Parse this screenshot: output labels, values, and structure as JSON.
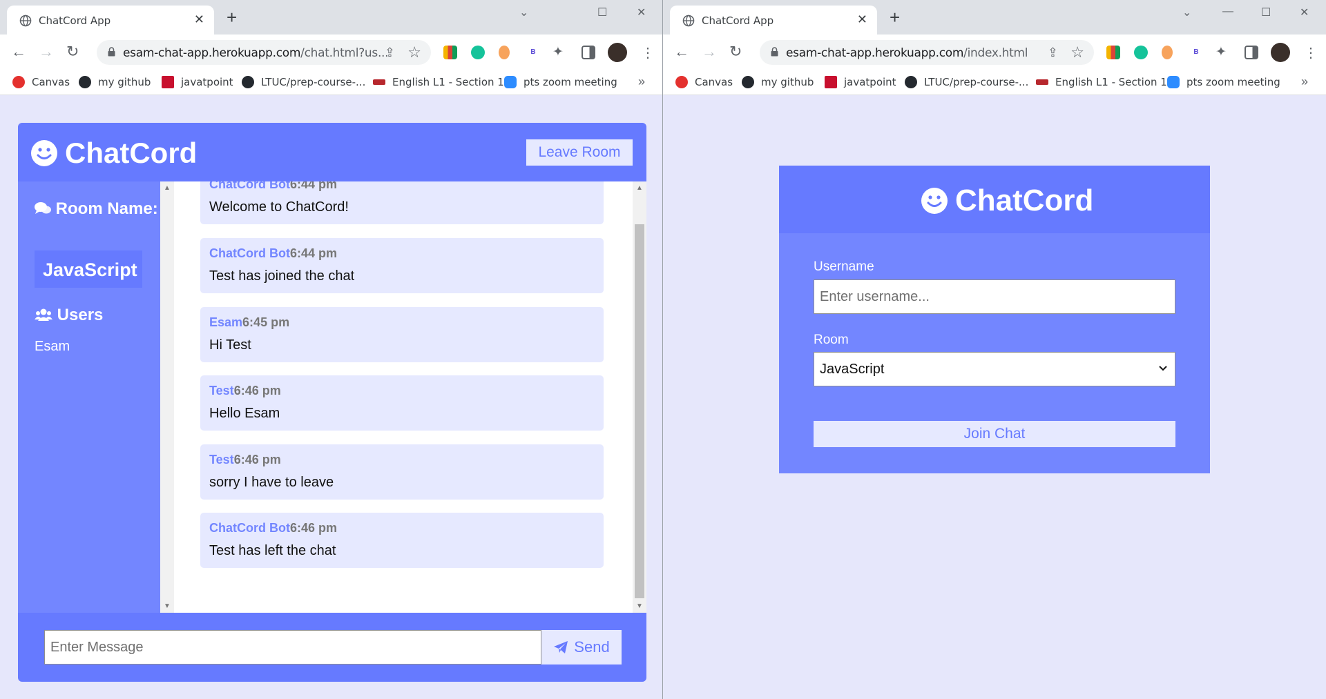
{
  "left_window": {
    "tab_title": "ChatCord App",
    "url_domain": "esam-chat-app.herokuapp.com",
    "url_path": "/chat.html?us...",
    "bookmarks": [
      {
        "label": "Canvas",
        "color": "#e4312e"
      },
      {
        "label": "my github",
        "color": "#24292f"
      },
      {
        "label": "javatpoint",
        "color": "#c8102e"
      },
      {
        "label": "LTUC/prep-course-...",
        "color": "#24292f"
      },
      {
        "label": "English L1 - Section 1",
        "color": "#b7282e"
      },
      {
        "label": "pts zoom meeting",
        "color": "#2d8cff"
      }
    ],
    "chat": {
      "brand": "ChatCord",
      "leave_label": "Leave Room",
      "room_heading": "Room Name:",
      "room_name": "JavaScript",
      "users_heading": "Users",
      "users": [
        "Esam"
      ],
      "messages": [
        {
          "user": "ChatCord Bot",
          "time": "6:44 pm",
          "text": "Welcome to ChatCord!"
        },
        {
          "user": "ChatCord Bot",
          "time": "6:44 pm",
          "text": "Test has joined the chat"
        },
        {
          "user": "Esam",
          "time": "6:45 pm",
          "text": "Hi Test"
        },
        {
          "user": "Test",
          "time": "6:46 pm",
          "text": "Hello Esam"
        },
        {
          "user": "Test",
          "time": "6:46 pm",
          "text": "sorry I have to leave"
        },
        {
          "user": "ChatCord Bot",
          "time": "6:46 pm",
          "text": "Test has left the chat"
        }
      ],
      "message_placeholder": "Enter Message",
      "send_label": "Send"
    }
  },
  "right_window": {
    "tab_title": "ChatCord App",
    "url_domain": "esam-chat-app.herokuapp.com",
    "url_path": "/index.html",
    "bookmarks": [
      {
        "label": "Canvas",
        "color": "#e4312e"
      },
      {
        "label": "my github",
        "color": "#24292f"
      },
      {
        "label": "javatpoint",
        "color": "#c8102e"
      },
      {
        "label": "LTUC/prep-course-...",
        "color": "#24292f"
      },
      {
        "label": "English L1 - Section 1",
        "color": "#b7282e"
      },
      {
        "label": "pts zoom meeting",
        "color": "#2d8cff"
      }
    ],
    "join": {
      "brand": "ChatCord",
      "username_label": "Username",
      "username_placeholder": "Enter username...",
      "room_label": "Room",
      "room_selected": "JavaScript",
      "join_label": "Join Chat"
    }
  },
  "theme": {
    "primary": "#667aff",
    "secondary": "#7386ff",
    "light": "#e6e9ff",
    "page_bg": "#e6e7fb"
  },
  "icons": [
    "chrome-globe-icon",
    "close-icon",
    "plus-icon",
    "back-arrow-icon",
    "forward-arrow-icon",
    "reload-icon",
    "lock-icon",
    "share-icon",
    "star-icon",
    "extensions-puzzle-icon",
    "side-panel-icon",
    "kebab-menu-icon",
    "smiley-icon",
    "comments-icon",
    "users-icon",
    "paper-plane-icon",
    "chevron-down-icon"
  ]
}
